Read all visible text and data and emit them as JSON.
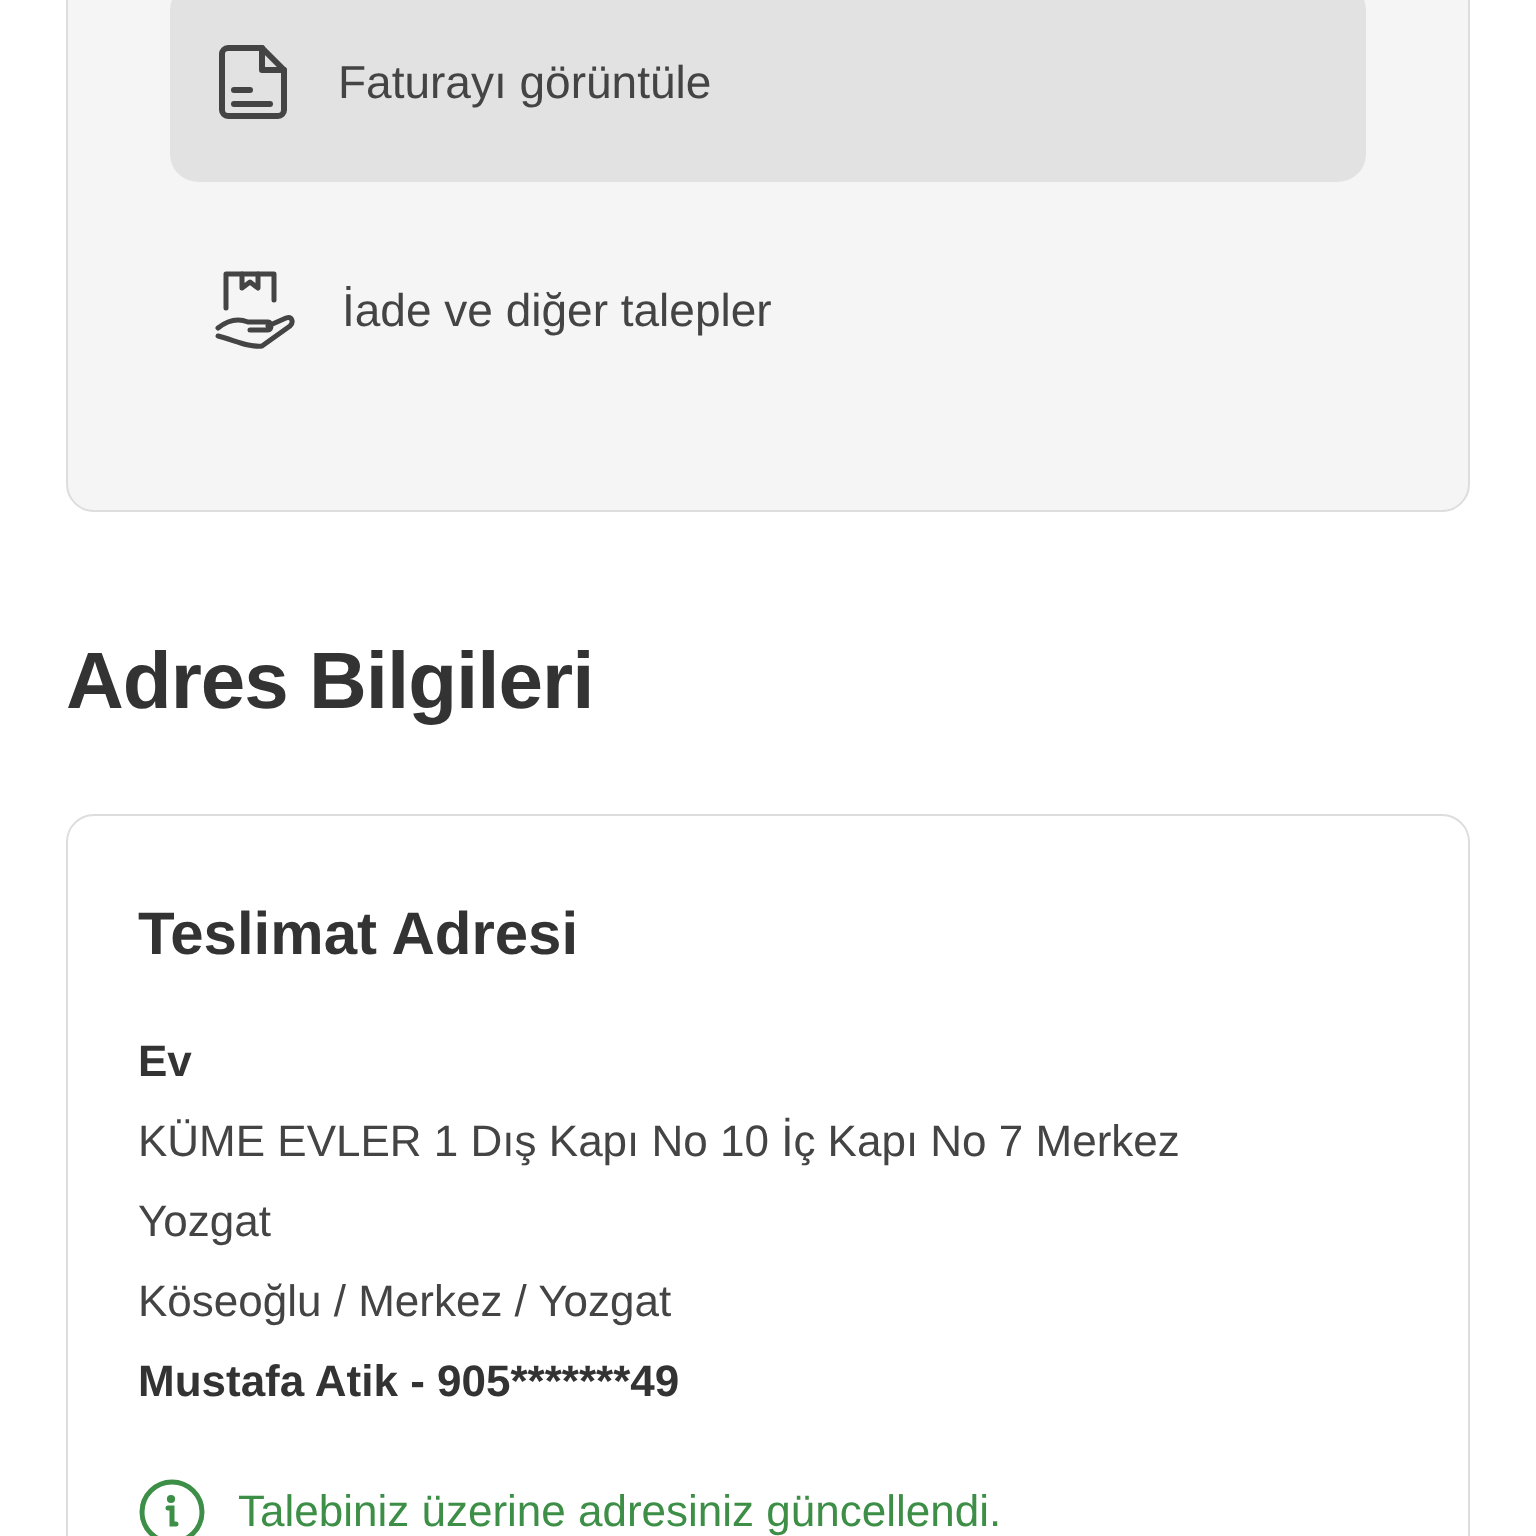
{
  "actions": [
    {
      "kind": "invoice",
      "label": "Faturayı görüntüle",
      "selected": true
    },
    {
      "kind": "return",
      "label": "İade ve diğer talepler",
      "selected": false
    }
  ],
  "address_section": {
    "title": "Adres Bilgileri",
    "card": {
      "title": "Teslimat Adresi",
      "address_name": "Ev",
      "lines": [
        "KÜME EVLER 1 Dış Kapı No 10 İç Kapı No 7 Merkez Yozgat",
        "Köseoğlu / Merkez / Yozgat"
      ],
      "contact": "Mustafa Atik - 905*******49",
      "notice": "Talebiniz üzerine adresiniz güncellendi."
    }
  }
}
